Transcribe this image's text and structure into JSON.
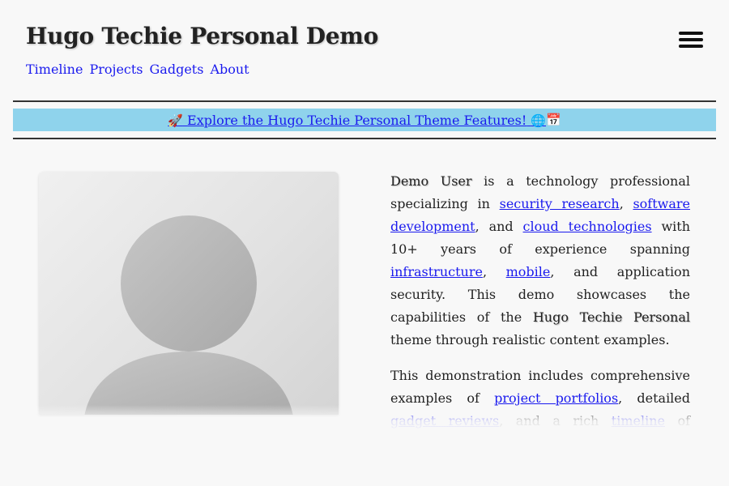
{
  "site": {
    "title": "Hugo Techie Personal Demo"
  },
  "nav": {
    "items": [
      {
        "label": "Timeline"
      },
      {
        "label": "Projects"
      },
      {
        "label": "Gadgets"
      },
      {
        "label": "About"
      }
    ]
  },
  "banner": {
    "rocket_emoji": "🚀",
    "link_text": "Explore the Hugo Techie Personal Theme Features!",
    "globe_emoji": "🌐",
    "calendar_emoji": "📅",
    "background_color": "#8fd3ec"
  },
  "avatar": {
    "icon": "user-silhouette-icon"
  },
  "bio": {
    "p1": {
      "name": "Demo User",
      "t1": " is a technology professional specializing in ",
      "l1": "security research",
      "t2": ", ",
      "l2": "software development",
      "t3": ", and ",
      "l3": "cloud technologies",
      "t4": " with 10+ years of experience spanning ",
      "l4": "infrastructure",
      "t5": ", ",
      "l5": "mobile",
      "t6": ", and application security. This demo showcases the capabilities of the ",
      "theme": "Hugo Techie Personal",
      "t7": " theme through realistic content examples."
    },
    "p2": {
      "t1": "This demonstration includes comprehensive examples of ",
      "l1": "project portfolios",
      "t2": ", detailed ",
      "l2": "gadget reviews",
      "t3": ", and a rich ",
      "l3": "timeline",
      "t4": " of professional ac-"
    }
  },
  "colors": {
    "link": "#1a1aee",
    "page_background": "#f8f8f8"
  },
  "menu": {
    "icon": "hamburger-menu-icon"
  }
}
